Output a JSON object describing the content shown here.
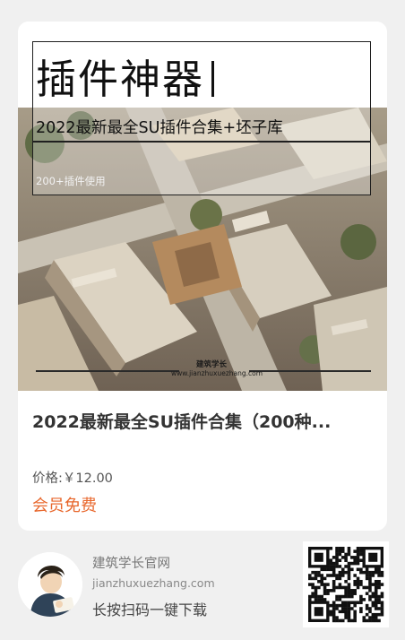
{
  "banner": {
    "title": "插件神器",
    "subtitle": "2022最新最全SU插件合集+坯子库",
    "caption": "200+插件使用",
    "watermark_cn": "建筑学长",
    "watermark_en": "www.jianzhuxuezhang.com"
  },
  "product": {
    "title": "2022最新最全SU插件合集（200种...",
    "price": "价格:￥12.00",
    "member_offer": "会员免费"
  },
  "footer": {
    "site_name": "建筑学长官网",
    "site_url": "jianzhuxuezhang.com",
    "scan_tip": "长按扫码一键下载"
  },
  "colors": {
    "accent": "#e8672c",
    "background": "#f0f0f0",
    "card": "#ffffff"
  },
  "icons": {
    "avatar": "avatar-illustration",
    "qr": "qr-code"
  }
}
